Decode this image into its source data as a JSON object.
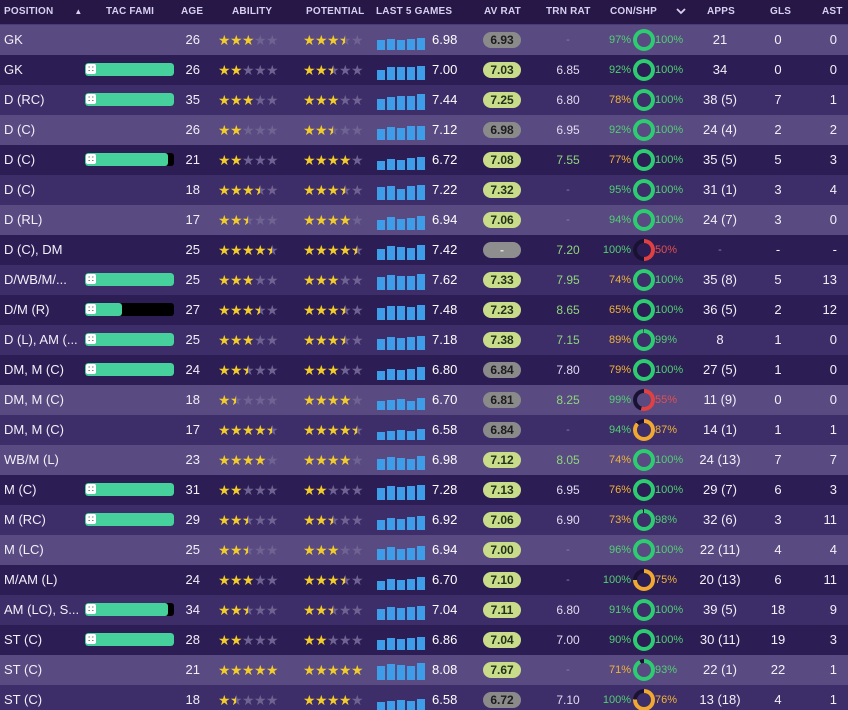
{
  "headers": {
    "position": "POSITION",
    "tac_fami": "TAC FAMI",
    "age": "AGE",
    "ability": "ABILITY",
    "potential": "POTENTIAL",
    "last5": "LAST 5 GAMES",
    "av_rat": "AV RAT",
    "trn_rat": "TRN RAT",
    "con_shp": "CON/SHP",
    "apps": "APPS",
    "gls": "GLS",
    "ast": "AST"
  },
  "icons": {
    "sort": "sort-ascending-icon",
    "dropdown": "chevron-down-icon",
    "familiarity": "tactics-board-icon",
    "star": "star-icon",
    "condition": "condition-ring-icon"
  },
  "colors": {
    "familiarity": "#46d19c",
    "stars": "#f2cc2a",
    "bars": "#3e9de8",
    "rating_good": "#c8dc89",
    "condition_green": "#2ecc71",
    "condition_orange": "#f0a830",
    "condition_red": "#e04040"
  },
  "rows": [
    {
      "position": "GK",
      "fam": null,
      "age": "26",
      "ability": 3,
      "potential": 3.5,
      "last5": [
        0.55,
        0.6,
        0.58,
        0.6,
        0.65
      ],
      "last5_avg": "6.98",
      "av": "6.93",
      "av_style": "k",
      "trn": "-",
      "con": "97%",
      "con_frac": 0.97,
      "shp": "100%",
      "shp_frac": 1.0,
      "apps": "21",
      "gls": "0",
      "ast": "0"
    },
    {
      "position": "GK",
      "fam": 1.0,
      "age": "26",
      "ability": 2,
      "potential": 2.5,
      "last5": [
        0.55,
        0.7,
        0.7,
        0.7,
        0.75
      ],
      "last5_avg": "7.00",
      "av": "7.03",
      "av_style": "g",
      "trn": "6.85",
      "trn_c": "wh",
      "con": "92%",
      "con_frac": 0.92,
      "shp": "100%",
      "shp_frac": 1.0,
      "apps": "34",
      "gls": "0",
      "ast": "0"
    },
    {
      "position": "D (RC)",
      "fam": 1.0,
      "age": "35",
      "ability": 3,
      "potential": 3,
      "last5": [
        0.6,
        0.7,
        0.8,
        0.75,
        0.9
      ],
      "last5_avg": "7.44",
      "av": "7.25",
      "av_style": "g",
      "trn": "6.80",
      "trn_c": "wh",
      "con": "78%",
      "con_frac": 0.78,
      "shp": "100%",
      "shp_frac": 1.0,
      "apps": "38 (5)",
      "gls": "7",
      "ast": "1"
    },
    {
      "position": "D (C)",
      "fam": null,
      "age": "26",
      "ability": 2,
      "potential": 2.5,
      "last5": [
        0.6,
        0.7,
        0.65,
        0.75,
        0.8
      ],
      "last5_avg": "7.12",
      "av": "6.98",
      "av_style": "k",
      "trn": "6.95",
      "trn_c": "wh",
      "con": "92%",
      "con_frac": 0.92,
      "shp": "100%",
      "shp_frac": 1.0,
      "apps": "24 (4)",
      "gls": "2",
      "ast": "2"
    },
    {
      "position": "D (C)",
      "fam": 0.93,
      "age": "21",
      "ability": 2,
      "potential": 4,
      "last5": [
        0.5,
        0.6,
        0.55,
        0.65,
        0.7
      ],
      "last5_avg": "6.72",
      "av": "7.08",
      "av_style": "g",
      "trn": "7.55",
      "trn_c": "gn",
      "con": "77%",
      "con_frac": 0.77,
      "shp": "100%",
      "shp_frac": 1.0,
      "apps": "35 (5)",
      "gls": "5",
      "ast": "3"
    },
    {
      "position": "D (C)",
      "fam": null,
      "age": "18",
      "ability": 3.5,
      "potential": 3.5,
      "last5": [
        0.7,
        0.8,
        0.6,
        0.75,
        0.85
      ],
      "last5_avg": "7.22",
      "av": "7.32",
      "av_style": "g",
      "trn": "-",
      "con": "95%",
      "con_frac": 0.95,
      "shp": "100%",
      "shp_frac": 1.0,
      "apps": "31 (1)",
      "gls": "3",
      "ast": "4"
    },
    {
      "position": "D (RL)",
      "fam": null,
      "age": "17",
      "ability": 2.5,
      "potential": 4,
      "last5": [
        0.55,
        0.7,
        0.6,
        0.65,
        0.75
      ],
      "last5_avg": "6.94",
      "av": "7.06",
      "av_style": "g",
      "trn": "-",
      "con": "94%",
      "con_frac": 0.94,
      "shp": "100%",
      "shp_frac": 1.0,
      "apps": "24 (7)",
      "gls": "3",
      "ast": "0"
    },
    {
      "position": "D (C), DM",
      "fam": null,
      "age": "25",
      "ability": 4.5,
      "potential": 4.5,
      "last5": [
        0.6,
        0.75,
        0.7,
        0.65,
        0.85
      ],
      "last5_avg": "7.42",
      "av": "-",
      "av_style": "n",
      "trn": "7.20",
      "trn_c": "gn",
      "con": "100%",
      "con_frac": 1.0,
      "shp": "50%",
      "shp_frac": 0.5,
      "apps": "-",
      "gls": "-",
      "ast": "-"
    },
    {
      "position": "D/WB/M/...",
      "fam": 1.0,
      "age": "25",
      "ability": 3,
      "potential": 3,
      "last5": [
        0.7,
        0.85,
        0.75,
        0.8,
        0.9
      ],
      "last5_avg": "7.62",
      "av": "7.33",
      "av_style": "g",
      "trn": "7.95",
      "trn_c": "gn",
      "con": "74%",
      "con_frac": 0.74,
      "shp": "100%",
      "shp_frac": 1.0,
      "apps": "35 (8)",
      "gls": "5",
      "ast": "13"
    },
    {
      "position": "D/M (R)",
      "fam": 0.42,
      "age": "27",
      "ability": 3.5,
      "potential": 3.5,
      "last5": [
        0.65,
        0.8,
        0.75,
        0.7,
        0.85
      ],
      "last5_avg": "7.48",
      "av": "7.23",
      "av_style": "g",
      "trn": "8.65",
      "trn_c": "gn",
      "con": "65%",
      "con_frac": 0.65,
      "shp": "100%",
      "shp_frac": 1.0,
      "apps": "36 (5)",
      "gls": "2",
      "ast": "12"
    },
    {
      "position": "D (L), AM (...",
      "fam": 1.0,
      "age": "25",
      "ability": 3,
      "potential": 3.5,
      "last5": [
        0.6,
        0.7,
        0.65,
        0.7,
        0.8
      ],
      "last5_avg": "7.18",
      "av": "7.38",
      "av_style": "g",
      "trn": "7.15",
      "trn_c": "gn",
      "con": "89%",
      "con_frac": 0.89,
      "shp": "99%",
      "shp_frac": 0.99,
      "apps": "8",
      "gls": "1",
      "ast": "0"
    },
    {
      "position": "DM, M (C)",
      "fam": 1.0,
      "age": "24",
      "ability": 2.5,
      "potential": 3,
      "last5": [
        0.5,
        0.6,
        0.55,
        0.6,
        0.7
      ],
      "last5_avg": "6.80",
      "av": "6.84",
      "av_style": "k",
      "trn": "7.80",
      "trn_c": "wh",
      "con": "79%",
      "con_frac": 0.79,
      "shp": "100%",
      "shp_frac": 1.0,
      "apps": "27 (5)",
      "gls": "1",
      "ast": "0"
    },
    {
      "position": "DM, M (C)",
      "fam": null,
      "age": "18",
      "ability": 1.5,
      "potential": 4,
      "last5": [
        0.5,
        0.55,
        0.6,
        0.5,
        0.65
      ],
      "last5_avg": "6.70",
      "av": "6.81",
      "av_style": "k",
      "trn": "8.25",
      "trn_c": "gn",
      "con": "99%",
      "con_frac": 0.99,
      "shp": "55%",
      "shp_frac": 0.55,
      "apps": "11 (9)",
      "gls": "0",
      "ast": "0"
    },
    {
      "position": "DM, M (C)",
      "fam": null,
      "age": "17",
      "ability": 4.5,
      "potential": 4.5,
      "last5": [
        0.45,
        0.5,
        0.55,
        0.5,
        0.6
      ],
      "last5_avg": "6.58",
      "av": "6.84",
      "av_style": "k",
      "trn": "-",
      "con": "94%",
      "con_frac": 0.94,
      "shp": "87%",
      "shp_frac": 0.87,
      "apps": "14 (1)",
      "gls": "1",
      "ast": "1"
    },
    {
      "position": "WB/M (L)",
      "fam": null,
      "age": "23",
      "ability": 4,
      "potential": 4,
      "last5": [
        0.6,
        0.7,
        0.65,
        0.6,
        0.75
      ],
      "last5_avg": "6.98",
      "av": "7.12",
      "av_style": "g",
      "trn": "8.05",
      "trn_c": "gn",
      "con": "74%",
      "con_frac": 0.74,
      "shp": "100%",
      "shp_frac": 1.0,
      "apps": "24 (13)",
      "gls": "7",
      "ast": "7"
    },
    {
      "position": "M (C)",
      "fam": 1.0,
      "age": "31",
      "ability": 2,
      "potential": 2,
      "last5": [
        0.65,
        0.75,
        0.7,
        0.8,
        0.85
      ],
      "last5_avg": "7.28",
      "av": "7.13",
      "av_style": "g",
      "trn": "6.95",
      "trn_c": "wh",
      "con": "76%",
      "con_frac": 0.76,
      "shp": "100%",
      "shp_frac": 1.0,
      "apps": "29 (7)",
      "gls": "6",
      "ast": "3"
    },
    {
      "position": "M (RC)",
      "fam": 1.0,
      "age": "29",
      "ability": 2.5,
      "potential": 2.5,
      "last5": [
        0.55,
        0.65,
        0.6,
        0.7,
        0.75
      ],
      "last5_avg": "6.92",
      "av": "7.06",
      "av_style": "g",
      "trn": "6.90",
      "trn_c": "wh",
      "con": "73%",
      "con_frac": 0.73,
      "shp": "98%",
      "shp_frac": 0.98,
      "apps": "32 (6)",
      "gls": "3",
      "ast": "11"
    },
    {
      "position": "M (LC)",
      "fam": null,
      "age": "25",
      "ability": 2.5,
      "potential": 3,
      "last5": [
        0.6,
        0.7,
        0.6,
        0.65,
        0.75
      ],
      "last5_avg": "6.94",
      "av": "7.00",
      "av_style": "g",
      "trn": "-",
      "con": "96%",
      "con_frac": 0.96,
      "shp": "100%",
      "shp_frac": 1.0,
      "apps": "22 (11)",
      "gls": "4",
      "ast": "4"
    },
    {
      "position": "M/AM (L)",
      "fam": null,
      "age": "24",
      "ability": 3,
      "potential": 3.5,
      "last5": [
        0.5,
        0.6,
        0.55,
        0.6,
        0.7
      ],
      "last5_avg": "6.70",
      "av": "7.10",
      "av_style": "g",
      "trn": "-",
      "con": "100%",
      "con_frac": 1.0,
      "shp": "75%",
      "shp_frac": 0.75,
      "apps": "20 (13)",
      "gls": "6",
      "ast": "11"
    },
    {
      "position": "AM (LC), S...",
      "fam": 0.93,
      "age": "34",
      "ability": 2.5,
      "potential": 2.5,
      "last5": [
        0.6,
        0.7,
        0.65,
        0.7,
        0.75
      ],
      "last5_avg": "7.04",
      "av": "7.11",
      "av_style": "g",
      "trn": "6.80",
      "trn_c": "wh",
      "con": "91%",
      "con_frac": 0.91,
      "shp": "100%",
      "shp_frac": 1.0,
      "apps": "39 (5)",
      "gls": "18",
      "ast": "9"
    },
    {
      "position": "ST (C)",
      "fam": 1.0,
      "age": "28",
      "ability": 2,
      "potential": 2,
      "last5": [
        0.55,
        0.65,
        0.6,
        0.65,
        0.7
      ],
      "last5_avg": "6.86",
      "av": "7.04",
      "av_style": "g",
      "trn": "7.00",
      "trn_c": "wh",
      "con": "90%",
      "con_frac": 0.9,
      "shp": "100%",
      "shp_frac": 1.0,
      "apps": "30 (11)",
      "gls": "19",
      "ast": "3"
    },
    {
      "position": "ST (C)",
      "fam": null,
      "age": "21",
      "ability": 5,
      "potential": 5,
      "last5": [
        0.75,
        0.9,
        0.85,
        0.8,
        0.95
      ],
      "last5_avg": "8.08",
      "av": "7.67",
      "av_style": "g",
      "trn": "-",
      "con": "71%",
      "con_frac": 0.71,
      "shp": "93%",
      "shp_frac": 0.93,
      "apps": "22 (1)",
      "gls": "22",
      "ast": "1"
    },
    {
      "position": "ST (C)",
      "fam": null,
      "age": "18",
      "ability": 1.5,
      "potential": 4,
      "last5": [
        0.45,
        0.5,
        0.55,
        0.5,
        0.6
      ],
      "last5_avg": "6.58",
      "av": "6.72",
      "av_style": "k",
      "trn": "7.10",
      "trn_c": "wh",
      "con": "100%",
      "con_frac": 1.0,
      "shp": "76%",
      "shp_frac": 0.76,
      "apps": "13 (18)",
      "gls": "4",
      "ast": "1"
    }
  ]
}
